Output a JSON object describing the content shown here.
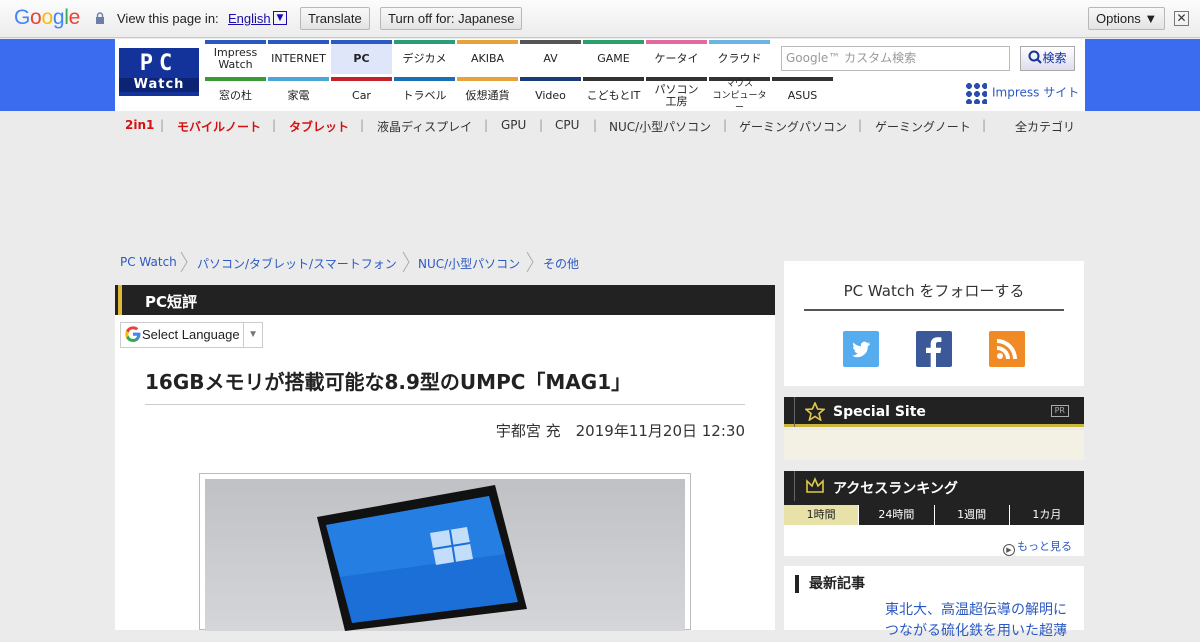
{
  "translate_bar": {
    "logo_text": "Google",
    "view_label": "View this page in:",
    "language": "English",
    "translate_button": "Translate",
    "turn_off_button": "Turn off for: Japanese",
    "options_button": "Options ▼",
    "close_symbol": "✕"
  },
  "header": {
    "logo_pc": "PC",
    "logo_watch": "Watch",
    "nav_row1": [
      {
        "label": "Impress\nWatch",
        "color": "#2b59c3"
      },
      {
        "label": "INTERNET",
        "color": "#2b59c3"
      },
      {
        "label": "PC",
        "color": "#2b59c3"
      },
      {
        "label": "デジカメ",
        "color": "#2a9d78"
      },
      {
        "label": "AKIBA",
        "color": "#e8a23a"
      },
      {
        "label": "AV",
        "color": "#555555"
      },
      {
        "label": "GAME",
        "color": "#2aa06a"
      },
      {
        "label": "ケータイ",
        "color": "#e26aa0"
      },
      {
        "label": "クラウド",
        "color": "#6bb5e6"
      }
    ],
    "nav_row2": [
      {
        "label": "窓の杜",
        "color": "#3a9a3a"
      },
      {
        "label": "家電",
        "color": "#4aa8d8"
      },
      {
        "label": "Car",
        "color": "#c8202a"
      },
      {
        "label": "トラベル",
        "color": "#1c6fb0"
      },
      {
        "label": "仮想通貨",
        "color": "#e8a23a"
      },
      {
        "label": "Video",
        "color": "#1b3c7a"
      },
      {
        "label": "こどもとIT",
        "color": "#333333"
      },
      {
        "label": "パソコン\n工房",
        "color": "#333333"
      },
      {
        "label": "マウス\nコンピューター",
        "color": "#333333"
      },
      {
        "label": "ASUS",
        "color": "#333333"
      }
    ],
    "search_placeholder": "Google™ カスタム検索",
    "search_button": "検索",
    "impress_site": "Impress サイト"
  },
  "subnav": {
    "items": [
      {
        "label": "2in1",
        "red": true
      },
      {
        "label": "モバイルノート",
        "red": true
      },
      {
        "label": "タブレット",
        "red": true
      },
      {
        "label": "液晶ディスプレイ",
        "red": false
      },
      {
        "label": "GPU",
        "red": false
      },
      {
        "label": "CPU",
        "red": false
      },
      {
        "label": "NUC/小型パソコン",
        "red": false
      },
      {
        "label": "ゲーミングパソコン",
        "red": false
      },
      {
        "label": "ゲーミングノート",
        "red": false
      }
    ],
    "all_categories": "全カテゴリ",
    "separator": "|"
  },
  "breadcrumb": [
    "PC Watch",
    "パソコン/タブレット/スマートフォン",
    "NUC/小型パソコン",
    "その他"
  ],
  "article": {
    "category": "PC短評",
    "select_language": "Select Language",
    "select_arrow": "▼",
    "title": "16GBメモリが搭載可能な8.9型のUMPC「MAG1」",
    "byline": "宇都宮 充　2019年11月20日 12:30"
  },
  "sidebar": {
    "follow_title": "PC Watch をフォローする",
    "sns": [
      {
        "name": "twitter",
        "color": "#55acee"
      },
      {
        "name": "facebook",
        "color": "#3b5998"
      },
      {
        "name": "rss",
        "color": "#f08a24"
      }
    ],
    "special_site": "Special Site",
    "pr_label": "PR",
    "ranking_title": "アクセスランキング",
    "ranking_tabs": [
      "1時間",
      "24時間",
      "1週間",
      "1カ月"
    ],
    "more_label": "もっと見る",
    "latest_heading": "最新記事",
    "latest_article": "東北大、高温超伝導の解明につながる硫化鉄を用いた超薄"
  }
}
